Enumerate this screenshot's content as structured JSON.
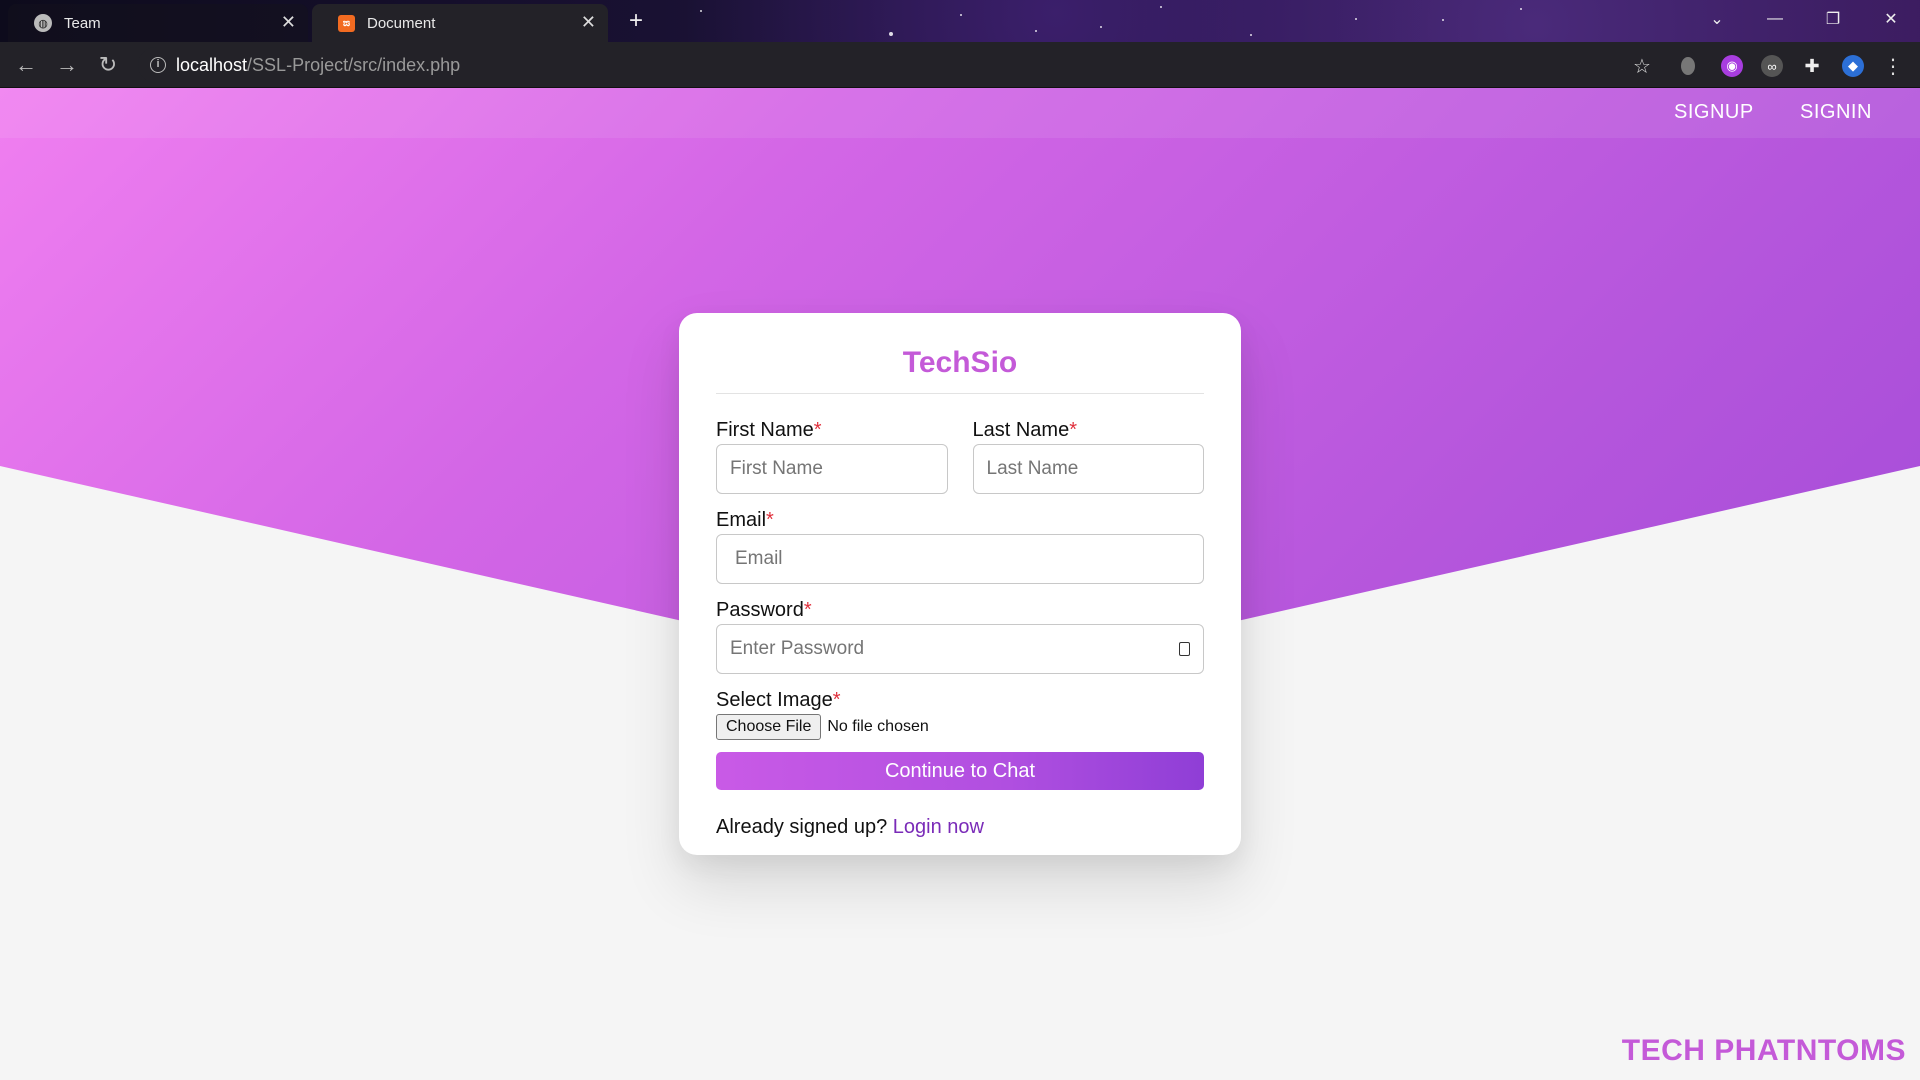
{
  "browser": {
    "tabs": [
      {
        "title": "Team",
        "active": false
      },
      {
        "title": "Document",
        "active": true
      }
    ],
    "url": {
      "host": "localhost",
      "path": "/SSL-Project/src/index.php"
    },
    "window_controls": {
      "dropdown": "⌄",
      "minimize": "—",
      "maximize": "❐",
      "close": "✕"
    },
    "new_tab": "+",
    "nav": {
      "back": "←",
      "forward": "→",
      "reload": "↻"
    }
  },
  "navbar": {
    "signup": "SIGNUP",
    "signin": "SIGNIN"
  },
  "form": {
    "brand": "TechSio",
    "first_name": {
      "label": "First Name",
      "placeholder": "First Name"
    },
    "last_name": {
      "label": "Last Name",
      "placeholder": "Last Name"
    },
    "email": {
      "label": "Email",
      "placeholder": "Email"
    },
    "password": {
      "label": "Password",
      "placeholder": "Enter Password"
    },
    "image": {
      "label": "Select Image",
      "button": "Choose File",
      "status": "No file chosen"
    },
    "required_mark": "*",
    "submit": "Continue to Chat",
    "signed_up_text": "Already signed up?",
    "login_link": "Login now"
  },
  "footer": {
    "brand": "TECH PHATNTOMS"
  },
  "colors": {
    "accent": "#c45ad8",
    "gradient_start": "#f07ff0",
    "gradient_end": "#9b45d6",
    "link": "#7a2bb8"
  }
}
